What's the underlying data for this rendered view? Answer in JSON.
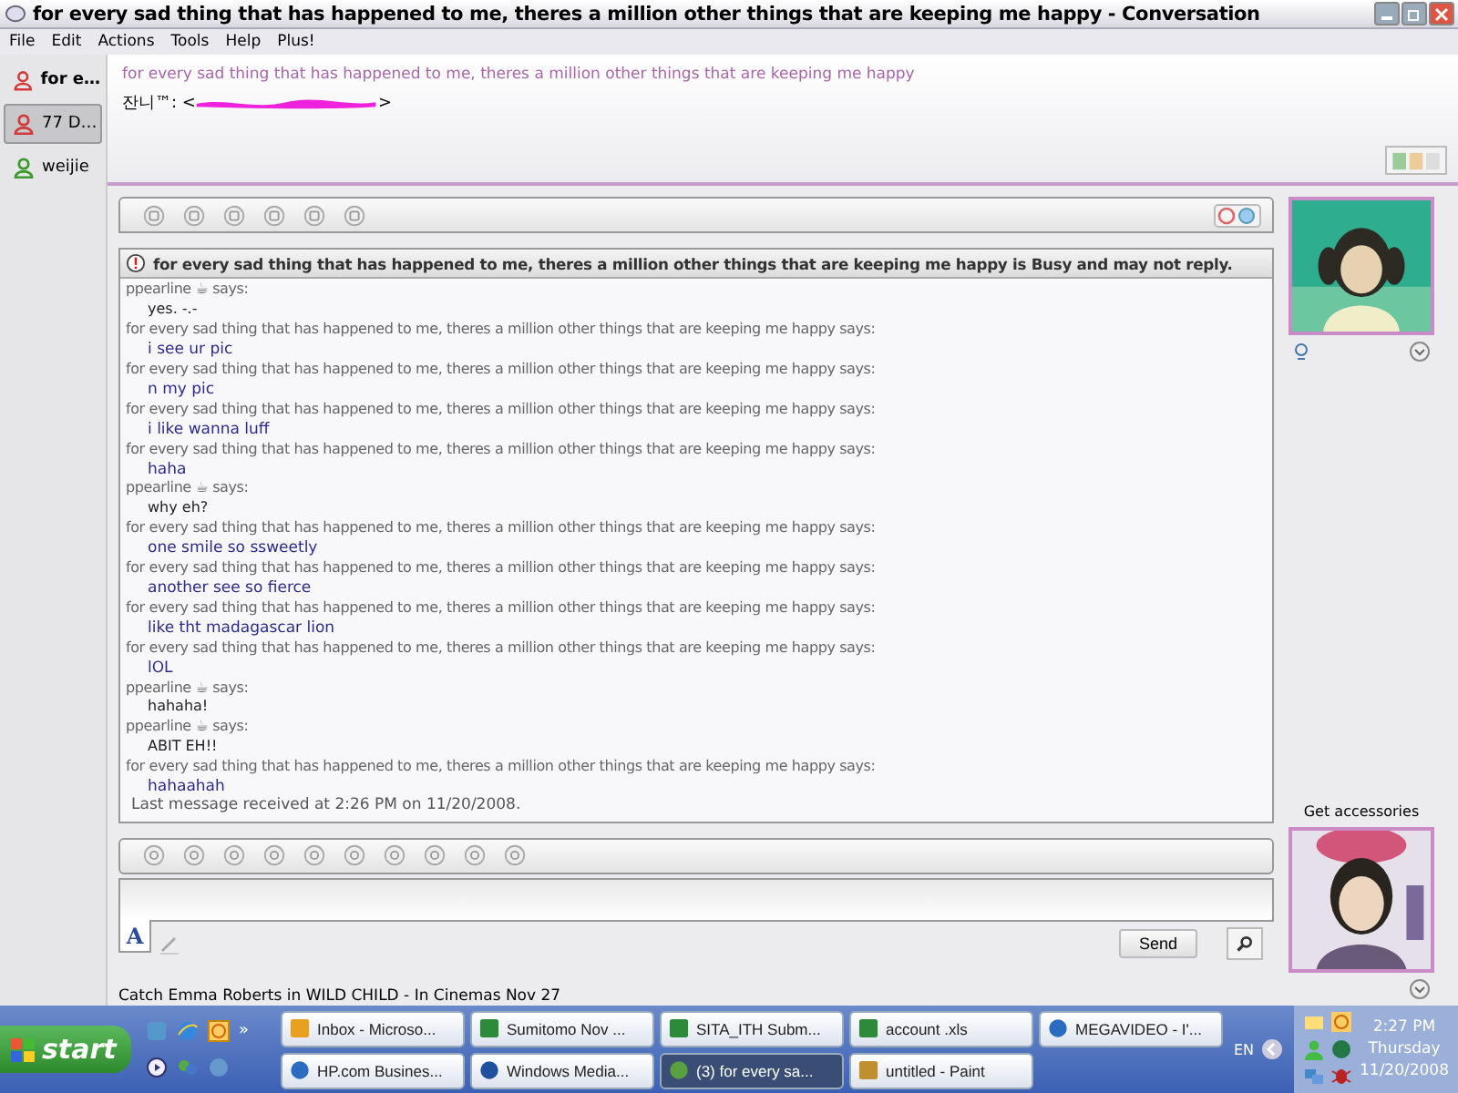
{
  "window": {
    "title": "for every sad thing that has happened to me, theres a million other things that are keeping me happy - Conversation"
  },
  "menu": [
    "File",
    "Edit",
    "Actions",
    "Tools",
    "Help",
    "Plus!"
  ],
  "sidebar": {
    "items": [
      {
        "label": "for e…",
        "selected": false,
        "bold": true,
        "color": "#d23a3a"
      },
      {
        "label": "77 D…",
        "selected": true,
        "bold": false,
        "color": "#d23a3a"
      },
      {
        "label": "weijie",
        "selected": false,
        "bold": false,
        "color": "#3a9a2a"
      }
    ]
  },
  "header": {
    "name": "for every sad thing that has happened to me, theres a million other things that are keeping me happy",
    "contact_prefix": "잔니™: <",
    "contact_suffix": ">"
  },
  "notice": "for every sad thing that has happened to me, theres a million other things that are keeping me happy is Busy and may not reply.",
  "messages": [
    {
      "kind": "contact",
      "sender": "ppearline ☕ says:",
      "text": "yes. -.-"
    },
    {
      "kind": "me",
      "sender": "for every sad thing that has happened to me, theres a million other things that are keeping me happy says:",
      "text": "i see ur pic"
    },
    {
      "kind": "me",
      "sender": "for every sad thing that has happened to me, theres a million other things that are keeping me happy says:",
      "text": "n my pic"
    },
    {
      "kind": "me",
      "sender": "for every sad thing that has happened to me, theres a million other things that are keeping me happy says:",
      "text": "i like wanna luff"
    },
    {
      "kind": "me",
      "sender": "for every sad thing that has happened to me, theres a million other things that are keeping me happy says:",
      "text": "haha"
    },
    {
      "kind": "contact",
      "sender": "ppearline ☕ says:",
      "text": "why eh?"
    },
    {
      "kind": "me",
      "sender": "for every sad thing that has happened to me, theres a million other things that are keeping me happy says:",
      "text": "one smile so ssweetly"
    },
    {
      "kind": "me",
      "sender": "for every sad thing that has happened to me, theres a million other things that are keeping me happy says:",
      "text": "another see so fierce"
    },
    {
      "kind": "me",
      "sender": "for every sad thing that has happened to me, theres a million other things that are keeping me happy says:",
      "text": "like tht madagascar lion"
    },
    {
      "kind": "me",
      "sender": "for every sad thing that has happened to me, theres a million other things that are keeping me happy says:",
      "text": "lOL"
    },
    {
      "kind": "contact",
      "sender": "ppearline ☕ says:",
      "text": "hahaha!"
    },
    {
      "kind": "contact",
      "sender": "ppearline ☕ says:",
      "text": "ABIT EH!!"
    },
    {
      "kind": "me",
      "sender": "for every sad thing that has happened to me, theres a million other things that are keeping me happy says:",
      "text": "hahaahah"
    }
  ],
  "last_message": "Last message received at 2:26 PM on 11/20/2008.",
  "format_letter": "A",
  "send_button": "Send",
  "accessories": "Get accessories",
  "ad_text": "Catch Emma Roberts in WILD CHILD - In Cinemas Nov 27",
  "taskbar": {
    "start": "start",
    "more": "»",
    "rows": [
      [
        {
          "label": "Inbox - Microso...",
          "kind": "mail",
          "selected": false
        },
        {
          "label": "Sumitomo Nov ...",
          "kind": "sheet",
          "selected": false
        },
        {
          "label": "SITA_ITH Subm...",
          "kind": "sheet",
          "selected": false
        },
        {
          "label": "account .xls",
          "kind": "sheet",
          "selected": false
        },
        {
          "label": "MEGAVIDEO - I'...",
          "kind": "web",
          "selected": false
        }
      ],
      [
        {
          "label": "HP.com Busines...",
          "kind": "web",
          "selected": false
        },
        {
          "label": "Windows Media...",
          "kind": "media",
          "selected": false
        },
        {
          "label": "(3) for every sa...",
          "kind": "chat",
          "selected": true
        },
        {
          "label": "untitled - Paint",
          "kind": "paint",
          "selected": false
        }
      ]
    ],
    "language": "EN",
    "time": "2:27 PM",
    "day": "Thursday",
    "date": "11/20/2008"
  }
}
